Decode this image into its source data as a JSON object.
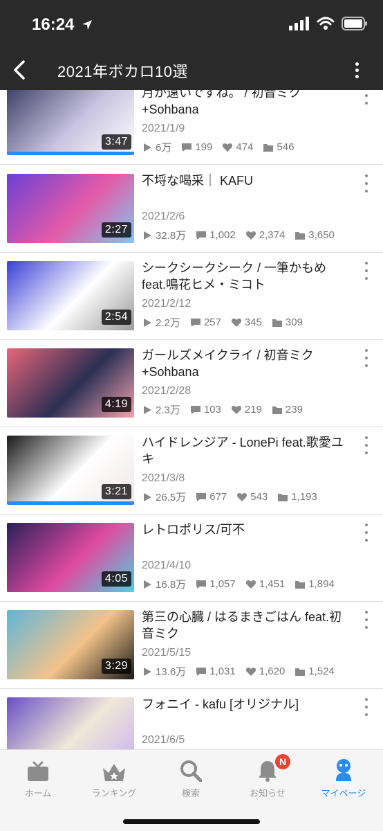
{
  "status": {
    "time": "16:24"
  },
  "header": {
    "title": "2021年ボカロ10選"
  },
  "videos": [
    {
      "title": "月が遠いですね。 / 初音ミク +Sohbana",
      "date": "2021/1/9",
      "duration": "3:47",
      "views": "6万",
      "comments": "199",
      "likes": "474",
      "mylists": "546",
      "thumb_colors": [
        "#3b3d66",
        "#c9c4e0",
        "#ffffff"
      ]
    },
    {
      "title": "不埒な喝采｜ KAFU",
      "date": "2021/2/6",
      "duration": "2:27",
      "views": "32.8万",
      "comments": "1,002",
      "likes": "2,374",
      "mylists": "3,650",
      "thumb_colors": [
        "#6b3fd4",
        "#e45aa8",
        "#7fc8f0"
      ]
    },
    {
      "title": "シークシークシーク / 一筆かもめ feat.鳴花ヒメ・ミコト",
      "date": "2021/2/12",
      "duration": "2:54",
      "views": "2.2万",
      "comments": "257",
      "likes": "345",
      "mylists": "309",
      "thumb_colors": [
        "#3a3fd6",
        "#ffffff",
        "#9a9a9a"
      ]
    },
    {
      "title": "ガールズメイクライ / 初音ミク +Sohbana",
      "date": "2021/2/28",
      "duration": "4:19",
      "views": "2.3万",
      "comments": "103",
      "likes": "219",
      "mylists": "239",
      "thumb_colors": [
        "#e8667a",
        "#2c2f55",
        "#f4a3ad"
      ]
    },
    {
      "title": "ハイドレンジア - LonePi feat.歌愛ユキ",
      "date": "2021/3/8",
      "duration": "3:21",
      "views": "26.5万",
      "comments": "677",
      "likes": "543",
      "mylists": "1,193",
      "thumb_colors": [
        "#1a1a1a",
        "#ffffff",
        "#f0e6e6"
      ]
    },
    {
      "title": "レトロポリス/可不",
      "date": "2021/4/10",
      "duration": "4:05",
      "views": "16.8万",
      "comments": "1,057",
      "likes": "1,451",
      "mylists": "1,894",
      "thumb_colors": [
        "#2a1f5a",
        "#e04aa0",
        "#4fd0e0"
      ]
    },
    {
      "title": "第三の心臓 / はるまきごはん feat.初音ミク",
      "date": "2021/5/15",
      "duration": "3:29",
      "views": "13.6万",
      "comments": "1,031",
      "likes": "1,620",
      "mylists": "1,524",
      "thumb_colors": [
        "#5fb6d8",
        "#f3c38a",
        "#1c1c1c"
      ]
    },
    {
      "title": "フォニイ - kafu [オリジナル]",
      "date": "2021/6/5",
      "duration": "",
      "views": "",
      "comments": "",
      "likes": "",
      "mylists": "",
      "thumb_colors": [
        "#6a4fc2",
        "#f0e8d8",
        "#c9b2f0"
      ]
    }
  ],
  "tabs": [
    {
      "label": "ホーム",
      "icon": "tv-icon"
    },
    {
      "label": "ランキング",
      "icon": "crown-icon"
    },
    {
      "label": "検索",
      "icon": "search-icon"
    },
    {
      "label": "お知らせ",
      "icon": "bell-icon",
      "badge": "N"
    },
    {
      "label": "マイページ",
      "icon": "person-icon",
      "active": true
    }
  ],
  "colors": {
    "accent": "#2a8cf0",
    "header_bg": "#2a2a2a",
    "badge": "#e8442f"
  }
}
